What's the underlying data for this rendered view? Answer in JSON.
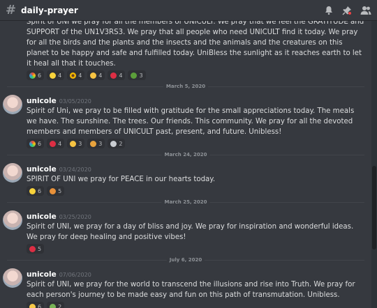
{
  "channel": {
    "name": "daily-prayer"
  },
  "icons": {
    "bell": "bell-icon",
    "pin": "pin-icon",
    "members": "members-icon"
  },
  "messages": [
    {
      "continuation": true,
      "text": "Spirit of UNI we pray for all the members of UNICULT. We pray that we feel the GRATITUDE and SUPPORT of the UN1V3RS3. We pray that all people who need UNICULT find it today. We pray for all the birds and the plants and the insects and the animals and the creatures on this planet to be happy and safe and fulfilled today. UniBless the sunlight as it reaches earth to let it heal all that it touches.",
      "reactions": [
        "6",
        "4",
        "4",
        "4",
        "4",
        "3"
      ]
    },
    {
      "date": "March 5, 2020",
      "user": "unicole",
      "time": "03/05/2020",
      "text": "Spirit of Uni, we pray to be filled with gratitude for the small appreciations today. The meals we have. The sunshine. The trees. Our friends. This community. We pray for all the devoted members and members of UNICULT past, present, and future. Unibless!",
      "reactions": [
        "6",
        "4",
        "3",
        "3",
        "2"
      ]
    },
    {
      "date": "March 24, 2020",
      "user": "unicole",
      "time": "03/24/2020",
      "text": "SPIRIT OF UNI we pray for PEACE in our hearts today.",
      "reactions": [
        "6",
        "5"
      ]
    },
    {
      "date": "March 25, 2020",
      "user": "unicole",
      "time": "03/25/2020",
      "text": "Spirit of UNI, we pray for a day of bliss and joy. We pray for inspiration and wonderful ideas. We pray for deep healing and positive vibes!",
      "reactions": [
        "5"
      ]
    },
    {
      "date": "July 6, 2020",
      "user": "unicole",
      "time": "07/06/2020",
      "text": "Spirit of UNI, we pray for the world to transcend the illusions and rise into Truth. We pray for each person's journey to be made easy and fun on this path of transmutation. Unibless.",
      "reactions": [
        "6",
        "2"
      ]
    }
  ]
}
